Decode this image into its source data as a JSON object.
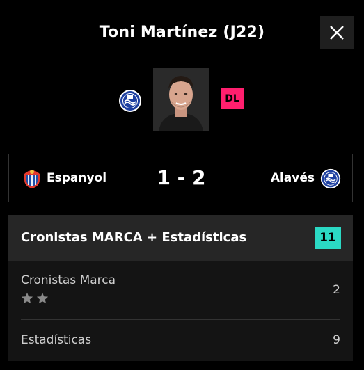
{
  "header": {
    "title": "Toni Martínez (J22)",
    "close_icon": "close-icon"
  },
  "player": {
    "position_badge": "DL",
    "position_color": "#ff1f6e",
    "team_crest_icon": "alaves-crest-icon"
  },
  "match": {
    "home_team": "Espanyol",
    "score": "1 - 2",
    "away_team": "Alavés",
    "home_crest_icon": "espanyol-crest-icon",
    "away_crest_icon": "alaves-crest-icon"
  },
  "points_panel": {
    "title": "Cronistas MARCA + Estadísticas",
    "total": "11",
    "total_color": "#2bd9c4",
    "rows": [
      {
        "label": "Cronistas Marca",
        "value": "2",
        "stars": 2
      },
      {
        "label": "Estadísticas",
        "value": "9"
      }
    ]
  }
}
